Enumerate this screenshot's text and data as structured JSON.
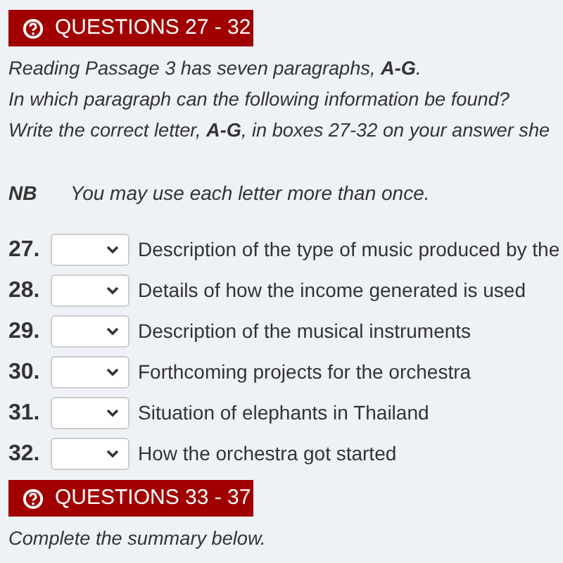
{
  "sections": [
    {
      "title": "QUESTIONS 27 - 32",
      "instructions": [
        "Reading Passage 3 has seven paragraphs, **A-G**.",
        "In which paragraph can the following information be found?",
        "Write the correct letter, **A-G**, in boxes 27-32 on your answer she"
      ],
      "note": {
        "label": "NB",
        "text": "You may use each letter more than once."
      },
      "questions": [
        {
          "number": "27.",
          "text": "Description of the type of music produced by the"
        },
        {
          "number": "28.",
          "text": "Details of how the income generated is used"
        },
        {
          "number": "29.",
          "text": "Description of the musical instruments"
        },
        {
          "number": "30.",
          "text": "Forthcoming projects for the orchestra"
        },
        {
          "number": "31.",
          "text": "Situation of elephants in Thailand"
        },
        {
          "number": "32.",
          "text": "How the orchestra got started"
        }
      ]
    },
    {
      "title": "QUESTIONS 33 - 37",
      "instructions": [
        "Complete the summary below."
      ]
    }
  ]
}
